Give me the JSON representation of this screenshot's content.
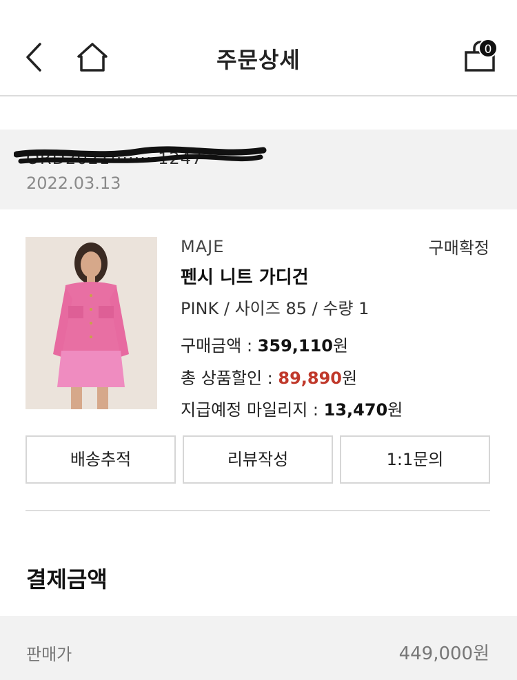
{
  "header": {
    "title": "주문상세",
    "back_icon": "chevron-left-icon",
    "home_icon": "home-icon",
    "bag_icon": "shopping-bag-icon",
    "bag_count": "0"
  },
  "order": {
    "number": "ORD2021········1247",
    "date": "2022.03.13"
  },
  "product": {
    "brand": "MAJE",
    "status": "구매확정",
    "name": "펜시 니트 가디건",
    "options": "PINK / 사이즈 85 / 수량 1",
    "purchase_label": "구매금액 : ",
    "purchase_value": "359,110",
    "discount_label": "총 상품할인 : ",
    "discount_value": "89,890",
    "mileage_label": "지급예정 마일리지 : ",
    "mileage_value": "13,470",
    "won": "원"
  },
  "actions": {
    "tracking": "배송추적",
    "review": "리뷰작성",
    "inquiry": "1:1문의"
  },
  "payment": {
    "title": "결제금액",
    "rows": [
      {
        "label": "판매가",
        "value": "449,000원"
      }
    ]
  },
  "colors": {
    "discount": "#c0392b",
    "band": "#f2f2f2"
  }
}
